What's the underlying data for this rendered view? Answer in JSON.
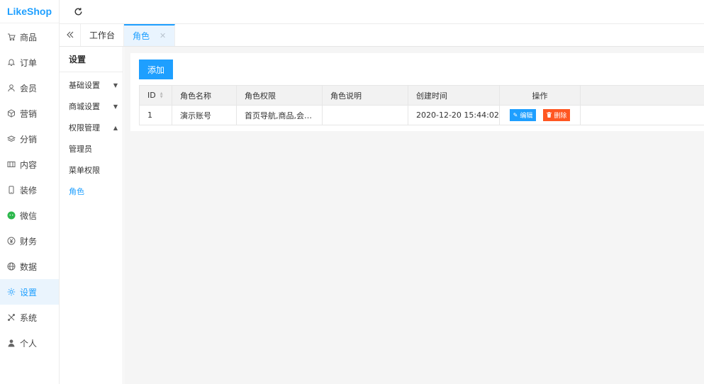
{
  "app": {
    "logo": "LikeShop"
  },
  "sidebar": {
    "items": [
      {
        "label": "商品",
        "icon": "cart-icon"
      },
      {
        "label": "订单",
        "icon": "bell-icon"
      },
      {
        "label": "会员",
        "icon": "user-icon"
      },
      {
        "label": "营销",
        "icon": "box-icon"
      },
      {
        "label": "分销",
        "icon": "layers-icon"
      },
      {
        "label": "内容",
        "icon": "image-icon"
      },
      {
        "label": "装修",
        "icon": "mobile-icon"
      },
      {
        "label": "微信",
        "icon": "wechat-icon"
      },
      {
        "label": "财务",
        "icon": "yen-icon"
      },
      {
        "label": "数据",
        "icon": "globe-icon"
      },
      {
        "label": "设置",
        "icon": "gear-icon",
        "active": true
      },
      {
        "label": "系统",
        "icon": "tools-icon"
      },
      {
        "label": "个人",
        "icon": "person-icon"
      }
    ]
  },
  "tabs": [
    {
      "label": "工作台"
    },
    {
      "label": "角色",
      "active": true
    }
  ],
  "submenu": {
    "title": "设置",
    "groups": [
      {
        "label": "基础设置"
      },
      {
        "label": "商城设置"
      },
      {
        "label": "权限管理"
      }
    ],
    "items": [
      {
        "label": "管理员"
      },
      {
        "label": "菜单权限"
      },
      {
        "label": "角色",
        "active": true
      }
    ]
  },
  "toolbar": {
    "add_label": "添加"
  },
  "table": {
    "headers": [
      "ID",
      "角色名称",
      "角色权限",
      "角色说明",
      "创建时间",
      "操作"
    ],
    "rows": [
      {
        "id": "1",
        "name": "演示账号",
        "perm": "首页导航,商品,会…",
        "desc": "",
        "time": "2020-12-20 15:44:02",
        "edit": "编辑",
        "del": "删除"
      }
    ]
  },
  "colors": {
    "accent": "#1e9fff",
    "danger": "#ff5722",
    "wechat": "#2db84d"
  }
}
